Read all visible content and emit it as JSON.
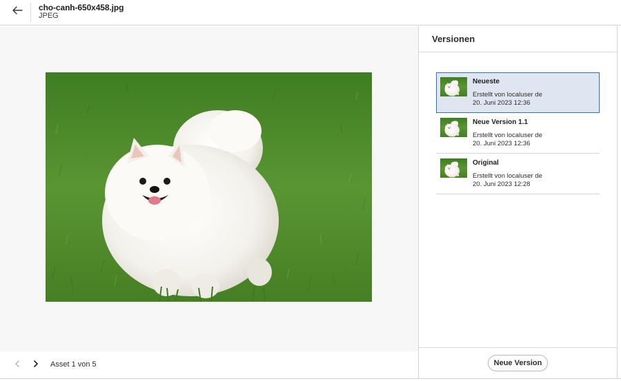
{
  "header": {
    "back_icon": "arrow-left-icon",
    "file_name": "cho-canh-650x458.jpg",
    "file_type": "JPEG"
  },
  "preview": {
    "image_description_icon": "photo-white-pomeranian-on-grass"
  },
  "footer": {
    "prev_icon": "chevron-left-icon",
    "next_icon": "chevron-right-icon",
    "asset_counter": "Asset 1 von 5"
  },
  "panel": {
    "title": "Versionen",
    "versions": [
      {
        "name": "Neueste",
        "created_by": "Erstellt von localuser de",
        "date": "20. Juni 2023 12:36",
        "selected": true
      },
      {
        "name": "Neue Version 1.1",
        "created_by": "Erstellt von localuser de",
        "date": "20. Juni 2023 12:36",
        "selected": false
      },
      {
        "name": "Original",
        "created_by": "Erstellt von localuser de",
        "date": "20. Juni 2023 12:28",
        "selected": false
      }
    ],
    "new_version_label": "Neue Version"
  },
  "colors": {
    "selected_bg": "#dfe6f1",
    "selected_border": "#2f6fc6",
    "grass": "#4f8a2a"
  }
}
